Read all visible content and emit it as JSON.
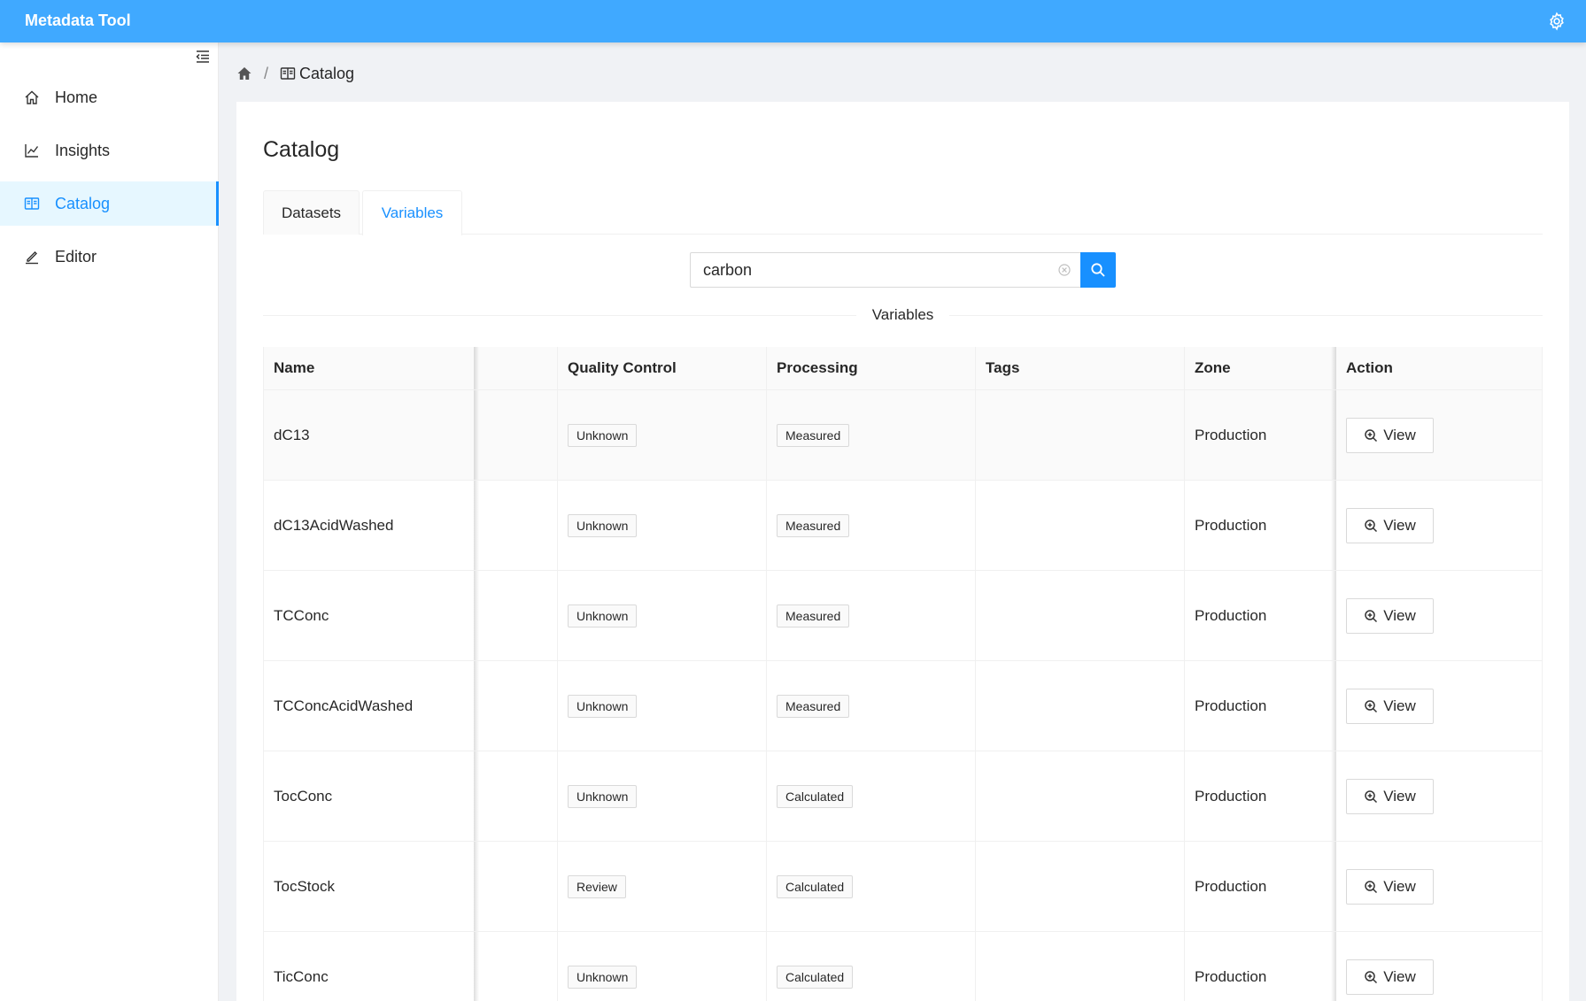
{
  "app": {
    "title": "Metadata Tool"
  },
  "sidebar": {
    "items": [
      {
        "label": "Home",
        "icon": "home-icon"
      },
      {
        "label": "Insights",
        "icon": "line-chart-icon"
      },
      {
        "label": "Catalog",
        "icon": "book-icon",
        "active": true
      },
      {
        "label": "Editor",
        "icon": "edit-icon"
      }
    ]
  },
  "breadcrumb": {
    "current": "Catalog"
  },
  "page": {
    "title": "Catalog"
  },
  "tabs": [
    {
      "label": "Datasets"
    },
    {
      "label": "Variables",
      "active": true
    }
  ],
  "search": {
    "value": "carbon"
  },
  "section": {
    "divider_label": "Variables"
  },
  "table": {
    "columns": {
      "name": "Name",
      "quality_control": "Quality Control",
      "processing": "Processing",
      "tags": "Tags",
      "zone": "Zone",
      "action": "Action"
    },
    "rows": [
      {
        "name": "dC13",
        "quality_control": "Unknown",
        "processing": "Measured",
        "tags": "",
        "zone": "Production",
        "action": "View"
      },
      {
        "name": "dC13AcidWashed",
        "quality_control": "Unknown",
        "processing": "Measured",
        "tags": "",
        "zone": "Production",
        "action": "View"
      },
      {
        "name": "TCConc",
        "quality_control": "Unknown",
        "processing": "Measured",
        "tags": "",
        "zone": "Production",
        "action": "View"
      },
      {
        "name": "TCConcAcidWashed",
        "quality_control": "Unknown",
        "processing": "Measured",
        "tags": "",
        "zone": "Production",
        "action": "View"
      },
      {
        "name": "TocConc",
        "quality_control": "Unknown",
        "processing": "Calculated",
        "tags": "",
        "zone": "Production",
        "action": "View"
      },
      {
        "name": "TocStock",
        "quality_control": "Review",
        "processing": "Calculated",
        "tags": "",
        "zone": "Production",
        "action": "View"
      },
      {
        "name": "TicConc",
        "quality_control": "Unknown",
        "processing": "Calculated",
        "tags": "",
        "zone": "Production",
        "action": "View"
      }
    ]
  },
  "colors": {
    "header_bg": "#40a9ff",
    "primary": "#1890ff",
    "active_menu_bg": "#e6f7ff"
  }
}
